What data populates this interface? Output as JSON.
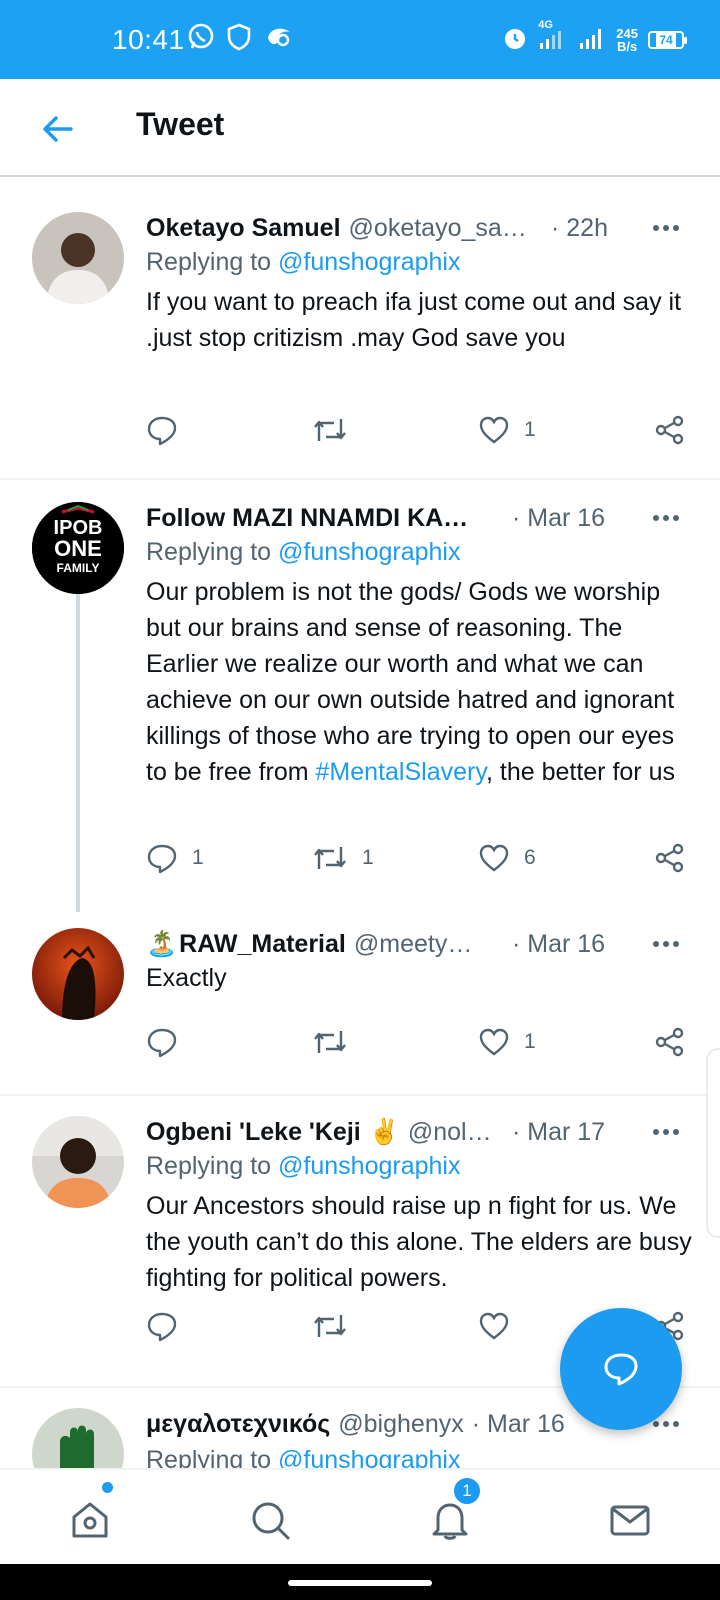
{
  "status_bar": {
    "time": "10:41",
    "network": "4G",
    "speed_value": "245",
    "speed_unit": "B/s",
    "battery": "74",
    "icons": [
      "whatsapp-icon",
      "shield-icon",
      "app-icon",
      "alarm-icon",
      "signal-icon",
      "battery-icon"
    ]
  },
  "header": {
    "title": "Tweet"
  },
  "colors": {
    "accent": "#1d9bf0",
    "status_bar": "#1da1f2",
    "muted": "#536471"
  },
  "tweets": [
    {
      "name": "Oketayo Samuel",
      "handle": "@oketayo_sa…",
      "time": "· 22h",
      "replying_label": "Replying to",
      "replying_to": "@funshographix",
      "text": "If you want to preach ifa just come out and say it .just stop critizism .may God save you",
      "reply_count": "",
      "retweet_count": "",
      "like_count": "1"
    },
    {
      "name": "Follow MAZI NNAMDI KA…",
      "handle": "",
      "time": "· Mar 16",
      "replying_label": "Replying to",
      "replying_to": "@funshographix",
      "avatar_text": [
        "IPOB",
        "ONE",
        "FAMILY"
      ],
      "text_before": "Our problem is not the gods/ Gods we worship but our brains and sense of reasoning. The Earlier we realize our worth and what we can achieve on our own outside hatred and ignorant killings of those who are trying to open our eyes to be free from ",
      "hashtag": "#MentalSlavery",
      "text_after": ", the better for us",
      "reply_count": "1",
      "retweet_count": "1",
      "like_count": "6"
    },
    {
      "name": "RAW_Material",
      "name_emoji": "🏝️",
      "handle": "@meety…",
      "time": "· Mar 16",
      "text": "Exactly",
      "reply_count": "",
      "retweet_count": "",
      "like_count": "1"
    },
    {
      "name": "Ogbeni 'Leke 'Keji",
      "name_emoji": "✌️",
      "handle": "@nol…",
      "time": "· Mar 17",
      "replying_label": "Replying to",
      "replying_to": "@funshographix",
      "text": "Our Ancestors should raise up n fight for us.  We the youth can’t do this alone. The elders are busy fighting for political powers.",
      "reply_count": "",
      "retweet_count": "",
      "like_count": ""
    },
    {
      "name": "μεγαλοτεχνικός",
      "handle": "@bighenyx",
      "time": "· Mar 16",
      "replying_label": "Replying to",
      "replying_to": "@funshographix"
    }
  ],
  "bottom_nav": {
    "notifications_badge": "1"
  }
}
